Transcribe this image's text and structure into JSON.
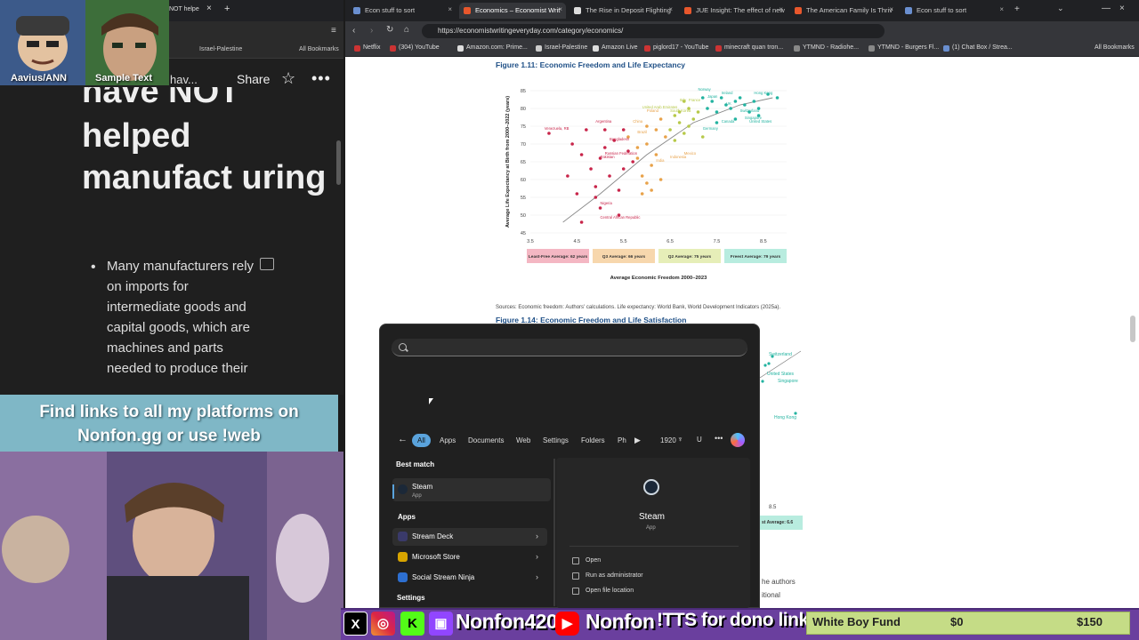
{
  "left_browser": {
    "tab_partial": "NOT helpe",
    "bookmark_item": "Israel-Palestine",
    "bookmark_all": "All Bookmarks",
    "doc_heading_partial": "have NOT",
    "doc_heading": "helped manufact uring",
    "doc_top_partial": "hav...",
    "share_label": "Share",
    "bullet_text": "Many manufacturers rely on imports for intermediate goods and capital goods, which are machines and parts needed to produce their"
  },
  "overlay": {
    "avatar_a_name": "Aavius/ANN",
    "avatar_b_name": "Sample Text",
    "banner_text": "Find links to all my platforms on Nonfon.gg or use !web"
  },
  "right_browser": {
    "tabs": [
      {
        "label": "Econ stuff to sort"
      },
      {
        "label": "Economics – Economist Writ"
      },
      {
        "label": "The Rise in Deposit Flighting"
      },
      {
        "label": "JUE Insight: The effect of new"
      },
      {
        "label": "The American Family Is Thriv"
      },
      {
        "label": "Econ stuff to sort"
      }
    ],
    "url": "https://economistwritingeveryday.com/category/economics/",
    "bookmarks": [
      "Netflix",
      "(304) YouTube",
      "Amazon.com: Prime...",
      "Israel-Palestine",
      "Amazon Live",
      "piglord17 - YouTube",
      "minecraft quan tron...",
      "YTMND - Radiohe...",
      "YTMND - Burgers Fl...",
      "(1) Chat Box / Strea..."
    ],
    "bookmarks_all": "All Bookmarks",
    "figure1_title": "Figure 1.11: Economic Freedom and Life Expectancy",
    "figure2_title": "Figure 1.14: Economic Freedom and Life Satisfaction",
    "sources": "Sources: Economic freedom: Authors' calculations. Life expectancy: World Bank, World Development Indicators (2025a).",
    "fig2_partial_labels": [
      "Switzerland",
      "United States",
      "Singapore",
      "Hong Kong"
    ],
    "fig2_partial_tick": "8.5",
    "fig2_partial_band": "st Average: 6.6",
    "right_text_partial_1": "he authors",
    "right_text_partial_2": "itional"
  },
  "chart_data": {
    "type": "scatter",
    "title": "Figure 1.11: Economic Freedom and Life Expectancy",
    "xlabel": "Average Economic Freedom 2000–2023",
    "ylabel": "Average Life Expectancy at Birth from 2000–2022 (years)",
    "xlim": [
      3.5,
      9.0
    ],
    "ylim": [
      45,
      85
    ],
    "xticks": [
      3.5,
      4.5,
      5.5,
      6.5,
      7.5,
      8.5
    ],
    "yticks": [
      45,
      50,
      55,
      60,
      65,
      70,
      75,
      80,
      85
    ],
    "series": [
      {
        "name": "Least-Free Average: 62 years",
        "color": "#c8254a",
        "points": [
          [
            3.9,
            73
          ],
          [
            4.3,
            61
          ],
          [
            4.4,
            70
          ],
          [
            4.5,
            56
          ],
          [
            4.6,
            67
          ],
          [
            4.7,
            74
          ],
          [
            4.8,
            63
          ],
          [
            4.9,
            58
          ],
          [
            5.0,
            66
          ],
          [
            5.1,
            69
          ],
          [
            5.2,
            61
          ],
          [
            5.3,
            71
          ],
          [
            5.4,
            57
          ],
          [
            5.5,
            63
          ],
          [
            5.0,
            52
          ],
          [
            4.9,
            55
          ],
          [
            5.4,
            50
          ],
          [
            5.6,
            68
          ],
          [
            5.7,
            65
          ],
          [
            4.6,
            48
          ],
          [
            5.1,
            74
          ],
          [
            5.5,
            74
          ]
        ]
      },
      {
        "name": "Q3 Average: 66 years",
        "color": "#e8a24a",
        "points": [
          [
            5.6,
            72
          ],
          [
            5.8,
            66
          ],
          [
            5.9,
            61
          ],
          [
            6.0,
            70
          ],
          [
            6.1,
            64
          ],
          [
            6.2,
            74
          ],
          [
            6.0,
            59
          ],
          [
            5.9,
            56
          ],
          [
            6.3,
            60
          ],
          [
            6.2,
            67
          ],
          [
            6.4,
            72
          ],
          [
            6.1,
            57
          ],
          [
            5.8,
            69
          ],
          [
            6.3,
            77
          ],
          [
            6.0,
            75
          ]
        ]
      },
      {
        "name": "Q2 Average: 75 years",
        "color": "#b7c94a",
        "points": [
          [
            6.5,
            74
          ],
          [
            6.6,
            78
          ],
          [
            6.7,
            76
          ],
          [
            6.8,
            73
          ],
          [
            6.9,
            80
          ],
          [
            7.0,
            77
          ],
          [
            6.6,
            71
          ],
          [
            6.8,
            82
          ],
          [
            7.1,
            79
          ],
          [
            6.9,
            75
          ],
          [
            7.2,
            72
          ],
          [
            6.7,
            79
          ]
        ]
      },
      {
        "name": "Freest Average: 79 years",
        "color": "#23b3a0",
        "points": [
          [
            7.3,
            80
          ],
          [
            7.4,
            82
          ],
          [
            7.5,
            79
          ],
          [
            7.6,
            83
          ],
          [
            7.7,
            81
          ],
          [
            7.8,
            80
          ],
          [
            7.9,
            82
          ],
          [
            8.0,
            83
          ],
          [
            8.1,
            81
          ],
          [
            8.2,
            79
          ],
          [
            8.3,
            82
          ],
          [
            8.4,
            80
          ],
          [
            8.6,
            84
          ],
          [
            8.8,
            83
          ],
          [
            7.5,
            76
          ],
          [
            7.9,
            77
          ],
          [
            8.4,
            78
          ],
          [
            7.2,
            83
          ]
        ]
      }
    ],
    "trendline": [
      [
        4.2,
        48
      ],
      [
        5.0,
        56
      ],
      [
        6.0,
        67
      ],
      [
        7.0,
        76
      ],
      [
        8.0,
        81
      ],
      [
        8.7,
        83
      ]
    ],
    "annotations": [
      "Venezuela, RB",
      "Argentina",
      "Bangladesh",
      "Russian Federation",
      "Pakistan",
      "Nigeria",
      "Central African Republic",
      "China",
      "Brazil",
      "India",
      "Indonesia",
      "Mexico",
      "Poland",
      "United Arab Emirates",
      "South Korea",
      "Italy",
      "France",
      "Norway",
      "Japan",
      "Ireland",
      "UK",
      "Switzerland",
      "Hong Kong",
      "Singapore",
      "Canada",
      "Germany",
      "United States"
    ],
    "bands": [
      {
        "label": "Least-Free Average: 62 years",
        "color": "#f4b7c3"
      },
      {
        "label": "Q3 Average: 66 years",
        "color": "#f7d7ad"
      },
      {
        "label": "Q2 Average: 75 years",
        "color": "#e6eeb8"
      },
      {
        "label": "Freest Average: 79 years",
        "color": "#b8ecdf"
      }
    ]
  },
  "search": {
    "filters": [
      "All",
      "Apps",
      "Documents",
      "Web",
      "Settings",
      "Folders",
      "Ph"
    ],
    "counter": "1920",
    "user_initial": "U",
    "best_match_header": "Best match",
    "best_match": {
      "name": "Steam",
      "type": "App"
    },
    "apps_header": "Apps",
    "apps": [
      {
        "name": "Stream Deck",
        "color": "#3a3a6a"
      },
      {
        "name": "Microsoft Store",
        "color": "#d7a400"
      },
      {
        "name": "Social Stream Ninja",
        "color": "#2d6fd0"
      }
    ],
    "settings_header": "Settings",
    "detail_name": "Steam",
    "detail_type": "App",
    "actions": [
      "Open",
      "Run as administrator",
      "Open file location"
    ]
  },
  "stream_bar": {
    "handle1": "Nonfon420",
    "handle2": "Nonfon",
    "tts": "!TTS for dono link",
    "fund_name": "White Boy Fund",
    "fund_current": "$0",
    "fund_goal": "$150"
  }
}
